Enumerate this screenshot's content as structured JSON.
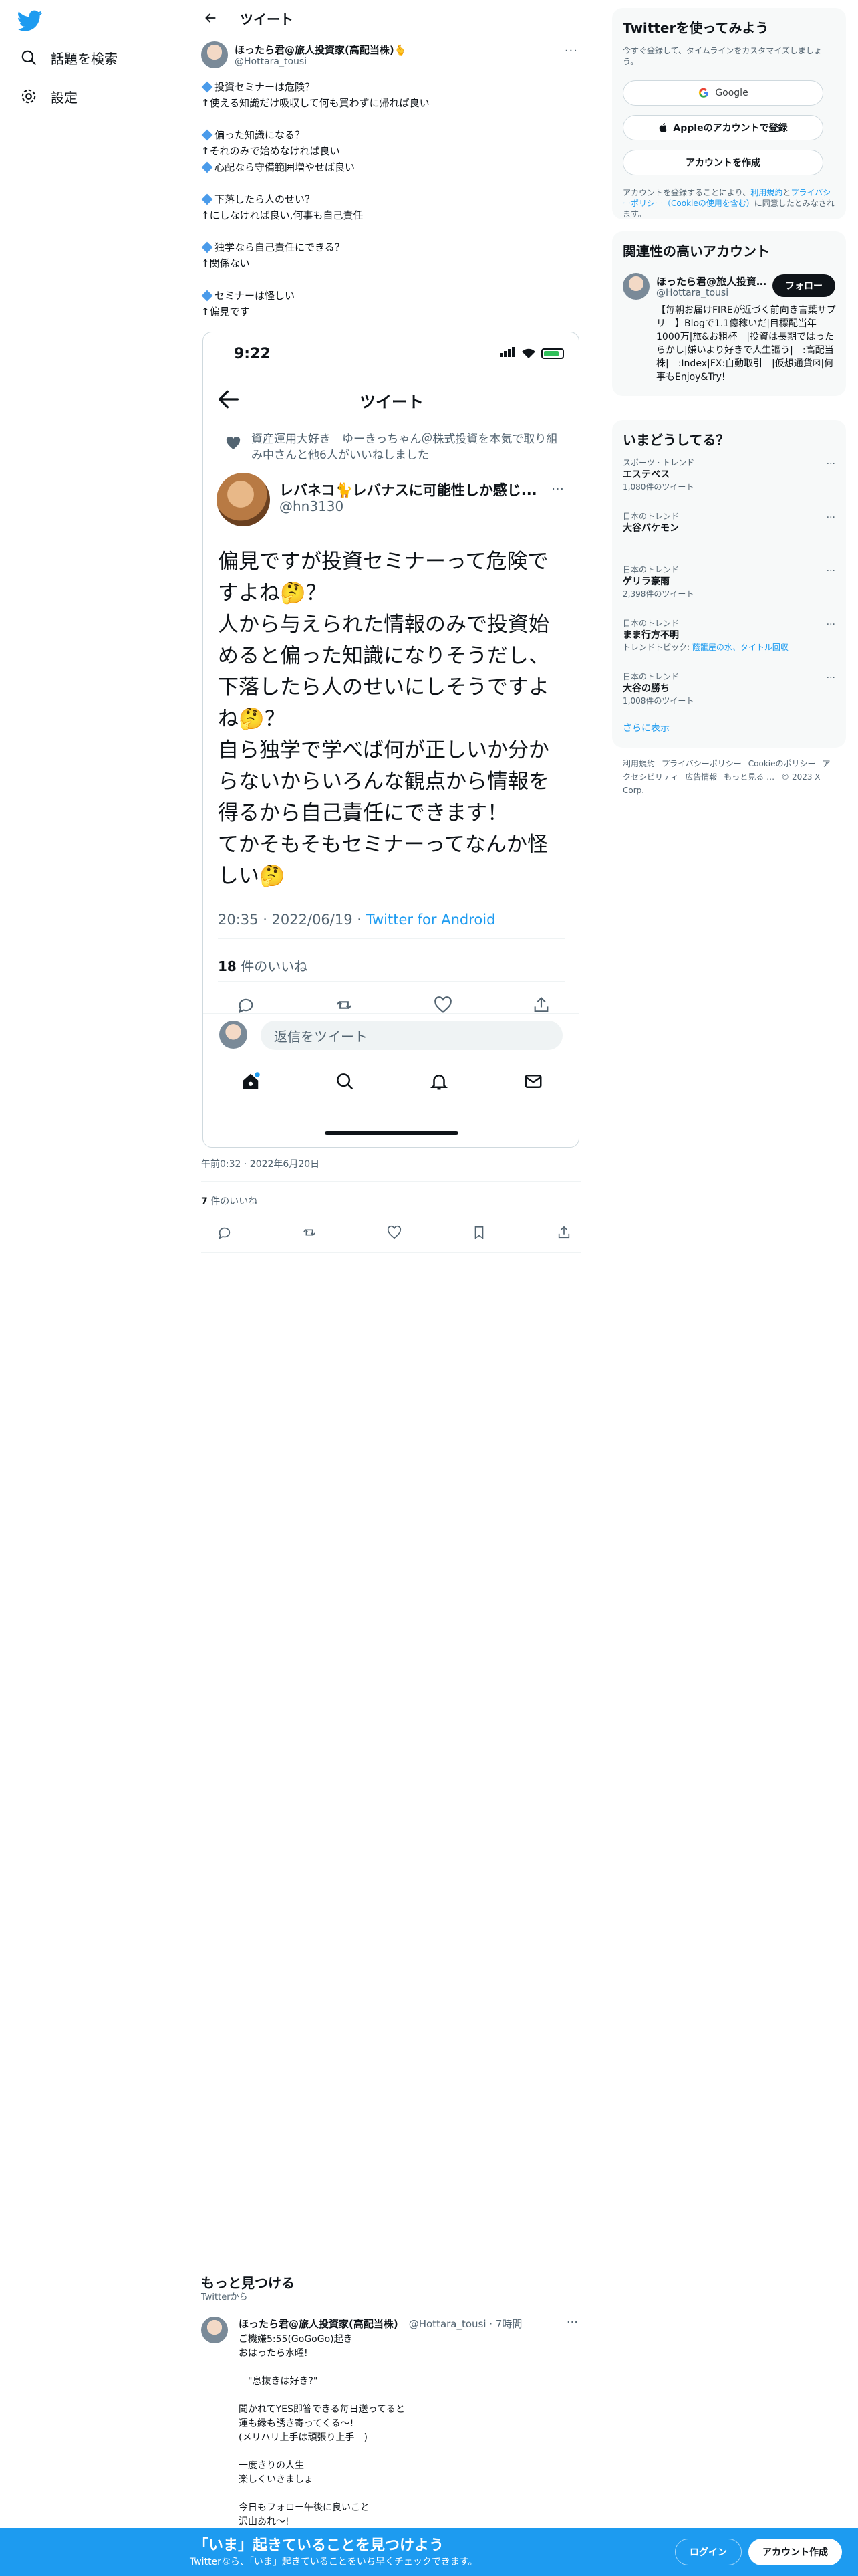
{
  "colors": {
    "accent": "#1d9bf0",
    "text": "#0f1419",
    "muted": "#536471",
    "banner": "#1d9bf0"
  },
  "sidebar": {
    "logo_icon": "twitter-bird-icon",
    "items": [
      {
        "label": "話題を検索",
        "icon": "search-icon"
      },
      {
        "label": "設定",
        "icon": "gear-icon"
      }
    ]
  },
  "header": {
    "title": "ツイート"
  },
  "tweet": {
    "author_name": "ほったら君@旅人投資家(高配当株)🫰",
    "author_handle": "@Hottara_tousi",
    "lines": [
      "投資セミナーは危険？",
      "↑使える知識だけ吸収して何も買わずに帰れば良い",
      "",
      "偏った知識になる？",
      "↑それのみで始めなければ良い",
      "心配なら守備範囲増やせば良い",
      "",
      "下落したら人のせい？",
      "↑にしなければ良い,何事も自己責任",
      "",
      "独学なら自己責任にできる？",
      "↑関係ない",
      "",
      "セミナーは怪しい",
      "↑偏見です"
    ],
    "timestamp": "午前0:32 · 2022年6月20日",
    "like_count": "7",
    "like_label": "件のいいね"
  },
  "screenshot": {
    "status_time": "9:22",
    "title": "ツイート",
    "liked_by": "資産運用大好き　ゆーきっちゃん＠株式投資を本気で取り組み中さんと他6人がいいねしました",
    "author_name": "レバネコ🐈レバナスに可能性しか感じ...",
    "author_handle": "@hn3130",
    "text_lines": [
      "偏見ですが投資セミナーって危険で",
      "すよね🤔？",
      "人から与えられた情報のみで投資始",
      "めると偏った知識になりそうだし、",
      "下落したら人のせいにしそうですよ",
      "ね🤔？",
      "自ら独学で学べば何が正しいか分か",
      "らないからいろんな観点から情報を",
      "得るから自己責任にできます！",
      "てかそもそもセミナーってなんか怪",
      "しい🤔"
    ],
    "meta_time": "20:35 · 2022/06/19 · ",
    "meta_via": "Twitter for Android",
    "like_count": "18",
    "like_label": "件のいいね",
    "reply_placeholder": "返信をツイート"
  },
  "more": {
    "title": "もっと見つける",
    "subtitle": "Twitterから",
    "tweet": {
      "author_name": "ほったら君@旅人投資家(高配当株)",
      "author_handle": "@Hottara_tousi · 7時間",
      "lines": [
        "ご機嫌5:55(GoGoGo)起き",
        "おはったら水曜!",
        "",
        "　\"息抜きは好き?\"",
        "",
        "聞かれてYES即答できる毎日送ってると",
        "運も縁も誘き寄ってくる〜!",
        "(メリハリ上手は頑張り上手　)",
        "",
        "一度きりの人生",
        "楽しくいきましょ",
        "",
        "今日もフォロー午後に良いこと",
        "沢山あれ〜!"
      ]
    }
  },
  "signup": {
    "title": "Twitterを使ってみよう",
    "description": "今すぐ登録して、タイムラインをカスタマイズしましょう。",
    "google_label": "Google",
    "apple_label": "Appleのアカウントで登録",
    "create_label": "アカウントを作成",
    "terms_prefix": "アカウントを登録することにより、",
    "terms_link1": "利用規約",
    "terms_and": "と",
    "terms_link2": "プライバシーポリシー（Cookieの使用を含む）",
    "terms_suffix": "に同意したとみなされます。"
  },
  "related": {
    "title": "関連性の高いアカウント",
    "name": "ほったら君@旅人投資家(高配当株)",
    "handle": "@Hottara_tousi",
    "follow_label": "フォロー",
    "bio": "【毎朝お届けFIREが近づく前向き言葉サプリ　】Blogで1.1億稼いだ|目標配当年1000万|旅&お粗杯　|投資は長期ではったらかし|嫌いより好きで人生謳う|　:高配当株|　:Index|FX:自動取引　|仮想通貨☒|何事もEnjoy&Try!"
  },
  "trends": {
    "title": "いまどうしてる？",
    "items": [
      {
        "context": "スポーツ · トレンド",
        "name": "エステベス",
        "count": "1,080件のツイート",
        "topics_label": "",
        "topics": ""
      },
      {
        "context": "日本のトレンド",
        "name": "大谷バケモン",
        "count": "",
        "topics_label": "",
        "topics": ""
      },
      {
        "context": "日本のトレンド",
        "name": "ゲリラ豪雨",
        "count": "2,398件のツイート",
        "topics_label": "",
        "topics": ""
      },
      {
        "context": "日本のトレンド",
        "name": "まま行方不明",
        "count": "",
        "topics_label": "トレンドトピック: ",
        "topics": "蔭籠屋の水、タイトル回収"
      },
      {
        "context": "日本のトレンド",
        "name": "大谷の勝ち",
        "count": "1,008件のツイート",
        "topics_label": "",
        "topics": ""
      }
    ],
    "show_more": "さらに表示"
  },
  "footer": {
    "links": [
      "利用規約",
      "プライバシーポリシー",
      "Cookieのポリシー",
      "アクセシビリティ",
      "広告情報",
      "もっと見る …",
      "© 2023 X Corp."
    ]
  },
  "banner": {
    "title": "「いま」起きていることを見つけよう",
    "subtitle": "Twitterなら、「いま」起きていることをいち早くチェックできます。",
    "login_label": "ログイン",
    "signup_label": "アカウント作成"
  }
}
